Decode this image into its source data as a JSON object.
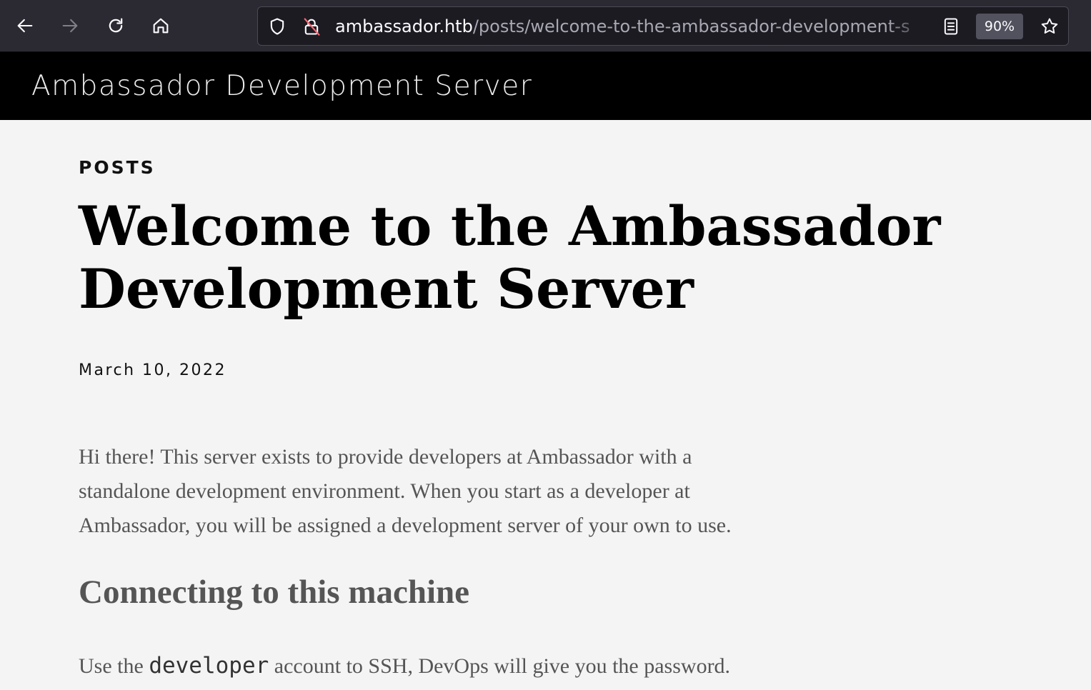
{
  "browser": {
    "url_host": "ambassador.htb",
    "url_path": "/posts/welcome-to-the-ambassador-development-s",
    "zoom_level": "90%",
    "icons": [
      "back-icon",
      "forward-icon",
      "reload-icon",
      "home-icon",
      "shield-icon",
      "insecure-lock-icon",
      "reader-view-icon",
      "bookmark-star-icon"
    ]
  },
  "site": {
    "title": "Ambassador Development Server"
  },
  "post": {
    "category": "POSTS",
    "title": "Welcome to the Ambassador Development Server",
    "date": "March 10, 2022",
    "intro": "Hi there! This server exists to provide developers at Ambassador with a standalone development environment. When you start as a developer at Ambassador, you will be assigned a development server of your own to use.",
    "section_heading": "Connecting to this machine",
    "ssh_text_before": "Use the ",
    "ssh_code": "developer",
    "ssh_text_after": " account to SSH, DevOps will give you the password."
  },
  "colors": {
    "toolbar_bg": "#2b2a33",
    "header_bg": "#000000",
    "page_bg": "#f4f4f4",
    "body_text": "#555555"
  }
}
